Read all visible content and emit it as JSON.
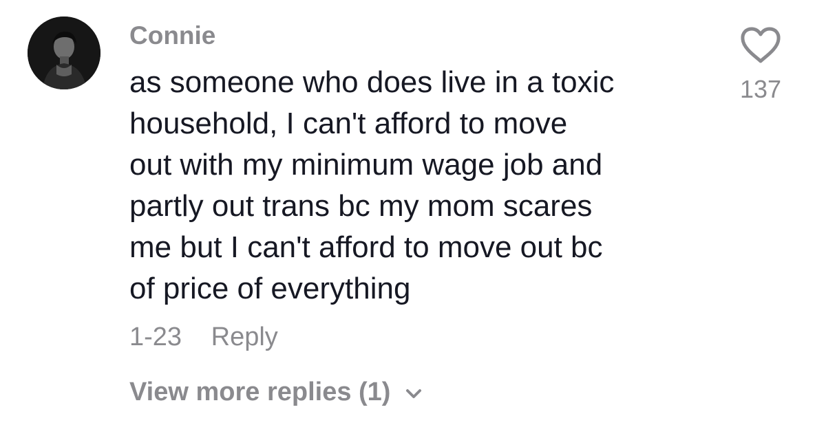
{
  "comment": {
    "username": "Connie",
    "text_lines": [
      "as someone who does live in a toxic",
      "household, I can't afford to move",
      "out with my minimum wage job and",
      "partly out trans bc my mom scares",
      "me but I can't afford to move out bc",
      "of price of everything"
    ],
    "date": "1-23",
    "reply_label": "Reply",
    "like_count": "137",
    "view_more_label": "View more replies (1)",
    "icons": {
      "like": "heart-outline-icon",
      "expand": "chevron-down-icon"
    }
  },
  "colors": {
    "text": "#161823",
    "muted": "#8a8a8e",
    "background": "#ffffff"
  }
}
